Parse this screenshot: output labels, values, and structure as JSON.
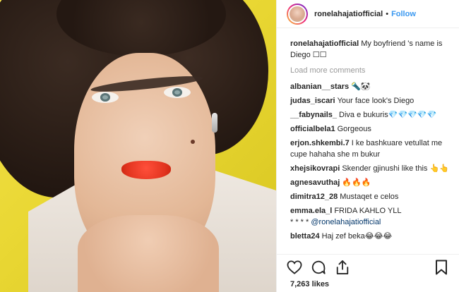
{
  "post": {
    "username": "ronelahajatiofficial",
    "follow_label": "Follow",
    "separator": "•",
    "caption_user": "ronelahajatiofficial",
    "caption_text": "My boyfriend 's name is Diego ☐☐",
    "load_more": "Load more comments",
    "likes": "7,263 likes"
  },
  "comments": [
    {
      "user": "albanian__stars",
      "text": "🔦🐼"
    },
    {
      "user": "judas_iscari",
      "text": "Your face look's Diego"
    },
    {
      "user": "__fabynails_",
      "text": "Diva e bukuris💎💎💎💎💎"
    },
    {
      "user": "officialbela1",
      "text": "Gorgeous"
    },
    {
      "user": "erjon.shkembi.7",
      "text": "I ke bashkuare vetullat me cupe hahaha she m bukur"
    },
    {
      "user": "xhejsikovrapi",
      "text": "Skender gjinushi like this 👆👆"
    },
    {
      "user": "agnesavuthaj",
      "text": "🔥🔥🔥"
    },
    {
      "user": "dimitra12_28",
      "text": "Mustaqet e celos"
    },
    {
      "user": "emma.ela_l",
      "text": "FRIDA KAHLO YLL"
    },
    {
      "user": "",
      "text": "* * * * ",
      "mention": "@ronelahajatiofficial"
    },
    {
      "user": "bletta24",
      "text": "Haj zef beka😂😂😂"
    }
  ],
  "icons": {
    "like": "heart-icon",
    "comment": "comment-icon",
    "share": "share-icon",
    "save": "bookmark-icon"
  },
  "colors": {
    "accent": "#3897f0",
    "link": "#003569",
    "background_photo": "#e9d733"
  }
}
